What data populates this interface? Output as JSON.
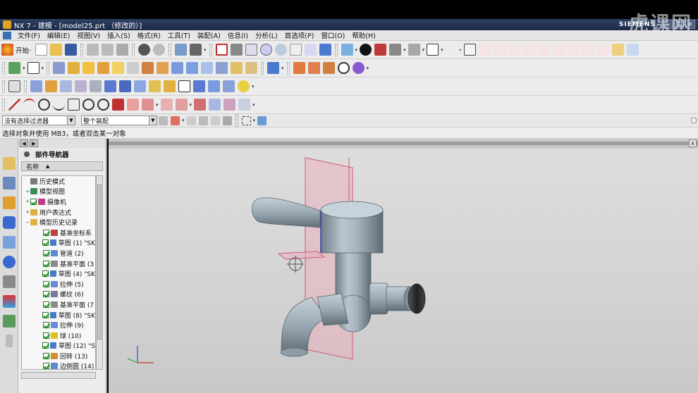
{
  "window": {
    "title": "NX 7 - 建模 - [model25.prt （修改的）]",
    "brand": "SIEMENS",
    "watermark": "虎课网",
    "controls": [
      "_",
      "□",
      "×"
    ]
  },
  "menu": [
    "文件(F)",
    "编辑(E)",
    "视图(V)",
    "插入(S)",
    "格式(R)",
    "工具(T)",
    "装配(A)",
    "信息(I)",
    "分析(L)",
    "首选项(P)",
    "窗口(O)",
    "帮助(H)"
  ],
  "toolbar": {
    "start_label": "开始·"
  },
  "selection": {
    "filter_value": "没有选择过滤器",
    "scope_value": "整个装配"
  },
  "status_text": "选择对象并使用 MB3，或者双击某一对象",
  "navigator": {
    "title": "部件导航器",
    "column_header": "名称",
    "items": [
      {
        "label": "历史模式",
        "icon": "clock-icon",
        "color": "#7a7a7a",
        "checked": false,
        "expand": ""
      },
      {
        "label": "模型视图",
        "icon": "model-views-icon",
        "color": "#3a8a5a",
        "checked": false,
        "expand": "+"
      },
      {
        "label": "摄像机",
        "icon": "camera-icon",
        "color": "#c03a8a",
        "checked": true,
        "expand": "+"
      },
      {
        "label": "用户表达式",
        "icon": "folder-icon",
        "color": "#e0b040",
        "checked": false,
        "expand": "+"
      },
      {
        "label": "模型历史记录",
        "icon": "folder-icon",
        "color": "#e0b040",
        "checked": false,
        "expand": "−"
      },
      {
        "label": "基准坐标系",
        "icon": "datum-csys-icon",
        "color": "#c04040",
        "checked": true,
        "expand": ""
      },
      {
        "label": "草图 (1) \"SK",
        "icon": "sketch-icon",
        "color": "#4a7ac0",
        "checked": true,
        "expand": ""
      },
      {
        "label": "管道 (2)",
        "icon": "tube-icon",
        "color": "#5a8ad0",
        "checked": true,
        "expand": ""
      },
      {
        "label": "基准平面 (3",
        "icon": "datum-plane-icon",
        "color": "#8a8a8a",
        "checked": true,
        "expand": ""
      },
      {
        "label": "草图 (4) \"SK",
        "icon": "sketch-icon",
        "color": "#4a7ac0",
        "checked": true,
        "expand": ""
      },
      {
        "label": "拉伸 (5)",
        "icon": "extrude-icon",
        "color": "#6a8ad8",
        "checked": true,
        "expand": ""
      },
      {
        "label": "螺纹 (6)",
        "icon": "thread-icon",
        "color": "#7a7aa0",
        "checked": true,
        "expand": ""
      },
      {
        "label": "基准平面 (7",
        "icon": "datum-plane-icon",
        "color": "#8a8a8a",
        "checked": true,
        "expand": ""
      },
      {
        "label": "草图 (8) \"SK",
        "icon": "sketch-icon",
        "color": "#4a7ac0",
        "checked": true,
        "expand": ""
      },
      {
        "label": "拉伸 (9)",
        "icon": "extrude-icon",
        "color": "#6a8ad8",
        "checked": true,
        "expand": ""
      },
      {
        "label": "球 (10)",
        "icon": "sphere-icon",
        "color": "#e0c020",
        "checked": true,
        "expand": ""
      },
      {
        "label": "草图 (12) \"S",
        "icon": "sketch-icon",
        "color": "#4a7ac0",
        "checked": true,
        "expand": ""
      },
      {
        "label": "回转 (13)",
        "icon": "revolve-icon",
        "color": "#d09030",
        "checked": true,
        "expand": ""
      },
      {
        "label": "边倒圆 (14)",
        "icon": "edge-blend-icon",
        "color": "#5a8ad0",
        "checked": true,
        "expand": ""
      }
    ]
  },
  "colors": {
    "titlebar": "#2d3f63",
    "part_color": "#9fb0bd",
    "datum_plane": "#e06b85"
  }
}
